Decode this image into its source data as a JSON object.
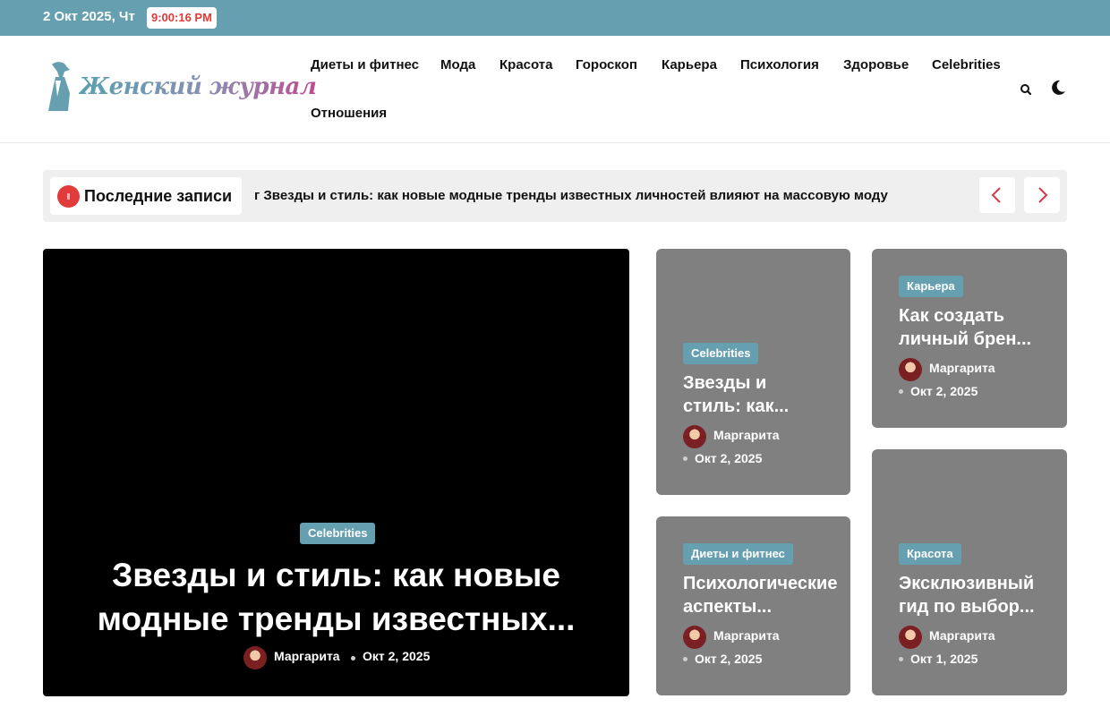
{
  "topbar": {
    "date": "2 Окт 2025, Чт",
    "time": "9:00:16 PM"
  },
  "logo": {
    "text": "Женский журнал"
  },
  "nav": {
    "items": [
      "Диеты и фитнес",
      "Мода",
      "Красота",
      "Гороскоп",
      "Карьера",
      "Психология",
      "Здоровье",
      "Celebrities",
      "Отношения"
    ]
  },
  "header_icons": {
    "search": "search-icon",
    "mode": "moon-icon"
  },
  "ticker": {
    "label": "Последние записи",
    "headline": "г Звезды и стиль: как новые модные тренды известных личностей влияют на массовую моду",
    "prev_icon": "chevron-left-icon",
    "next_icon": "chevron-right-icon"
  },
  "hero": {
    "category": "Celebrities",
    "title": "Звезды и стиль: как новые модные тренды известных...",
    "author": "Маргарита",
    "date": "Окт 2, 2025"
  },
  "cards": [
    {
      "category": "Celebrities",
      "title": "Звезды и стиль: как...",
      "author": "Маргарита",
      "date": "Окт 2, 2025"
    },
    {
      "category": "Карьера",
      "title": "Как создать личный брен...",
      "author": "Маргарита",
      "date": "Окт 2, 2025"
    },
    {
      "category": "Диеты и фитнес",
      "title": "Психологические аспекты...",
      "author": "Маргарита",
      "date": "Окт 2, 2025"
    },
    {
      "category": "Красота",
      "title": "Эксклюзивный гид по выбор...",
      "author": "Маргарита",
      "date": "Окт 1, 2025"
    }
  ],
  "colors": {
    "accent": "#66a0b0",
    "clock": "#e03a3a",
    "card_bg": "#808080",
    "ticker_bg": "#efefef"
  }
}
